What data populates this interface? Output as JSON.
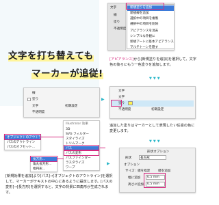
{
  "title": {
    "line1": "文字を打ち替えても",
    "line2": "マーカーが追従!"
  },
  "top_panel": {
    "menu": [
      "新規塗りを追加",
      "新規線を追加",
      "選択中の項目を複製",
      "選択中の項目を削除",
      "アピアランスを消去",
      "シンプルな外観に",
      "新規アートに基本アピアランスを適用",
      "マルチトーンを隠す"
    ],
    "type_label": "文字",
    "rows": [
      "線",
      "塗り",
      "不透明度"
    ]
  },
  "caption1": {
    "highlight": "[アピアランス]",
    "text": "から[新規塗りを追加]を選択して、文字色の後ろにもう一色塗りを追加します。"
  },
  "mid_panel": {
    "rows": [
      "線",
      "塗り",
      "文字",
      "不透明度"
    ],
    "sub_rows": [
      "文字",
      "文字",
      "塗り",
      "不透明度",
      "初期設定"
    ],
    "right_rows": [
      "文字",
      "文字",
      "塗り",
      "不透明度",
      "初期設定"
    ]
  },
  "caption2": "追加した塗りはマーカーとして表現したい任意の色に変更します。",
  "effect_menu": {
    "header": "Illustrator 効果",
    "items": [
      "3D",
      "SVG フィルター",
      "スタイライズ",
      "トリムマーク",
      "パス",
      "パスの変形",
      "パスファインダー",
      "ラスタライズ",
      "ワープ",
      "形状に変換"
    ],
    "left_items": [
      "オブジェクトのアウトライン",
      "パスのアウトライン",
      "パスのオフセット..."
    ],
    "right_items": [
      "パスのアウトライン",
      "パスのオフセット..."
    ],
    "shape_items": [
      "長方形...",
      "角丸長方形...",
      "楕円形..."
    ]
  },
  "caption3": "[新規効果を追加]より[パス]→[オブジェクトのアウトライン]を選択して、マーカーがテキストの中心にあるように設定します。[パスの変形]→[長方形]を選択すると、文字の背景に四角形が生成されます。",
  "shape_dialog": {
    "title": "形状オプション",
    "shape_label": "形状",
    "shape_value": "長方形",
    "section": "オプション",
    "width_label": "サイズ:",
    "width_opt1": "値を指定",
    "width_opt2": "値を追加",
    "add_width_label": "幅に追加",
    "add_width_value": "0.5 mm",
    "add_height_label": "高さに追加",
    "add_height_value": "0.5 mm"
  },
  "colors": {
    "accent": "#d6297f",
    "title_bg": "#fff9b0",
    "teal": "#2bb7c9",
    "bg_top": "#e9f5f9"
  }
}
